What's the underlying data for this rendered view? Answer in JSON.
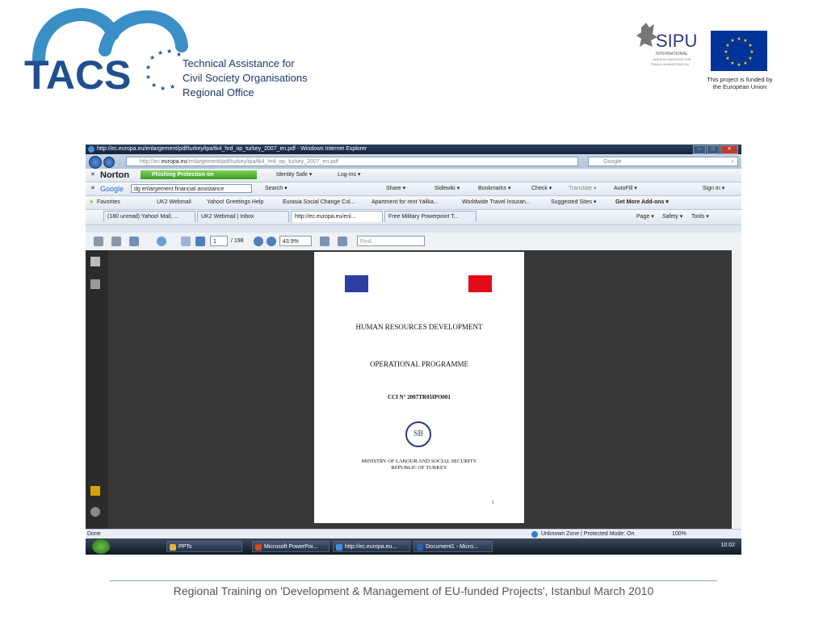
{
  "slide": {
    "org_lines": [
      "Technical Assistance for",
      "Civil Society Organisations",
      "Regional Office"
    ],
    "logo_text": "TACS",
    "sipu_name": "SIPU",
    "sipu_sub": [
      "INTERNATIONAL",
      "SWEDISH INSTITUTE FOR",
      "PUBLIC ADMINISTRATION"
    ],
    "funded_text": "This project is funded by the European Union",
    "footer": "Regional Training on 'Development & Management of EU-funded Projects', Istanbul March 2010",
    "colors": {
      "tacs_blue": "#3b8fc7",
      "tacs_navy": "#1f4f8f",
      "eu_blue": "#003399",
      "eu_gold": "#ffcc00"
    }
  },
  "browser": {
    "window_title": "http://ec.europa.eu/enlargement/pdf/turkey/ipa/tk4_hrd_op_turkey_2007_en.pdf - Windows Internet Explorer",
    "address_prefix": "http://ec.",
    "address_domain": "europa.eu",
    "address_rest": "/enlargement/pdf/turkey/ipa/tk4_hrd_op_turkey_2007_en.pdf",
    "search_placeholder": "Google",
    "norton": {
      "brand": "Norton",
      "phishing": "Phishing Protection on",
      "identity": "Identity Safe ▾",
      "logins": "Log-ins ▾"
    },
    "google_bar": {
      "brand": "Google",
      "query": "dg enlargement financial assistance",
      "items": [
        "Search ▾",
        "Share ▾",
        "Sidewiki ▾",
        "Bookmarks ▾",
        "Check ▾",
        "Translate ▾",
        "AutoFill ▾",
        "Sign In ▾"
      ]
    },
    "favorites": {
      "label": "Favorites",
      "items": [
        "UK2 Webmail",
        "Yahoo! Greetings Help",
        "Eurasia Social Change Col...",
        "Apartment for rent Yalika...",
        "Worldwide Travel Insuran...",
        "Suggested Sites ▾",
        "Get More Add-ons ▾"
      ]
    },
    "tabs": [
      "(180 unread) Yahoo! Mail, ...",
      "UK2 Webmail | Inbox",
      "http://ec.europa.eu/enl...",
      "Free Military Powerpoint T..."
    ],
    "command_bar": [
      "Page ▾",
      "Safety ▾",
      "Tools ▾"
    ],
    "pdf_toolbar": {
      "page_current": "1",
      "page_total": "/ 198",
      "zoom": "43.9%",
      "find_placeholder": "Find"
    },
    "document": {
      "title1": "HUMAN RESOURCES DEVELOPMENT",
      "title2": "OPERATIONAL PROGRAMME",
      "cci": "CCI N° 2007TR05IPO001",
      "ministry": "MINISTRY OF LABOUR AND SOCIAL SECURITY",
      "republic": "REPUBLIC OF TURKEY",
      "seal_text": "SB",
      "footnote": "1"
    },
    "status": {
      "left": "Done",
      "zone": "Unknown Zone | Protected Mode: On",
      "zoom": "100%"
    },
    "taskbar": {
      "items": [
        "PPTs",
        "Microsoft PowerPoi...",
        "http://ec.europa.eu...",
        "Document1 - Micro..."
      ],
      "clock": "10:02"
    }
  }
}
